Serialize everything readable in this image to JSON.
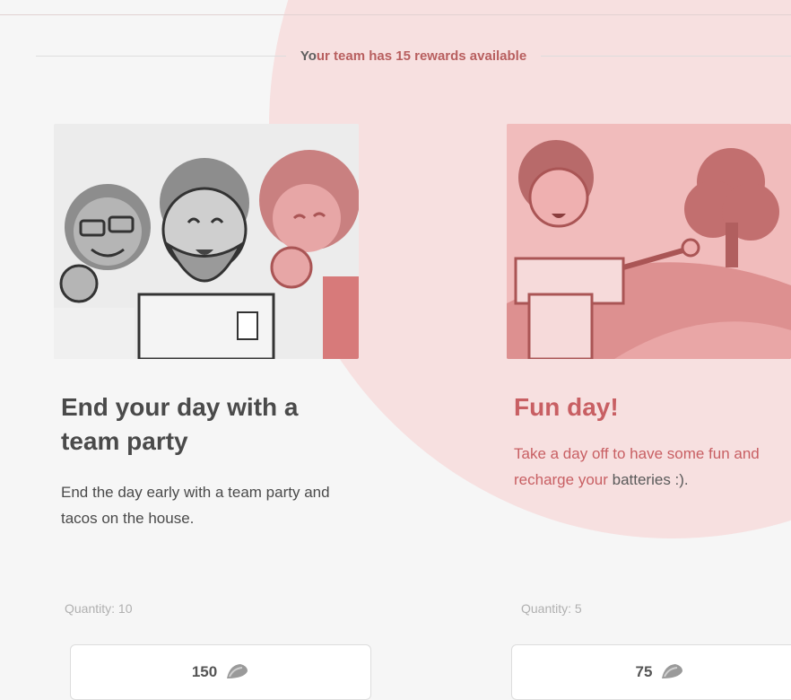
{
  "header": {
    "headline_prefix": "Yo",
    "headline_rest": "ur team has 15 rewards available"
  },
  "rewards": [
    {
      "title": "End your day with a team party",
      "description": "End the day early with a team party and tacos on the house.",
      "quantity": "Quantity: 10",
      "cost": "150",
      "cost_icon": "taco-icon"
    },
    {
      "title": "Fun day!",
      "description_highlight": "Take a day off to have some fun and recharge your",
      "description_rest": "batteries :).",
      "quantity": "Quantity: 5",
      "cost": "75",
      "cost_icon": "taco-icon"
    }
  ],
  "colors": {
    "accent": "#c85f63",
    "overlay": "#f8cece",
    "text": "#4a4a4a"
  }
}
